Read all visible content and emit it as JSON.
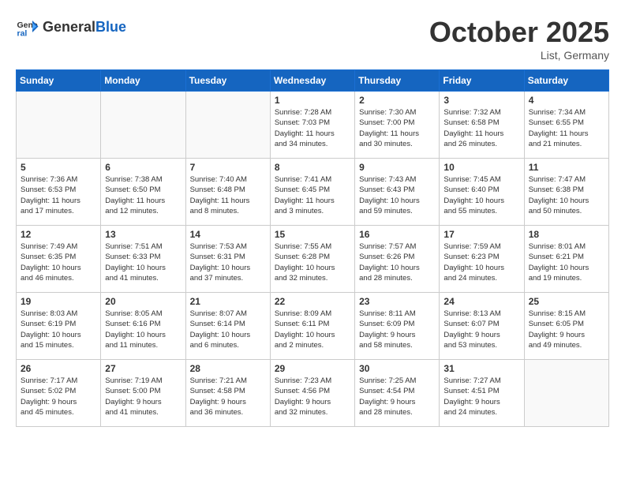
{
  "header": {
    "logo_line1": "General",
    "logo_line2": "Blue",
    "month_title": "October 2025",
    "location": "List, Germany"
  },
  "days_of_week": [
    "Sunday",
    "Monday",
    "Tuesday",
    "Wednesday",
    "Thursday",
    "Friday",
    "Saturday"
  ],
  "weeks": [
    [
      {
        "day": "",
        "info": ""
      },
      {
        "day": "",
        "info": ""
      },
      {
        "day": "",
        "info": ""
      },
      {
        "day": "1",
        "info": "Sunrise: 7:28 AM\nSunset: 7:03 PM\nDaylight: 11 hours\nand 34 minutes."
      },
      {
        "day": "2",
        "info": "Sunrise: 7:30 AM\nSunset: 7:00 PM\nDaylight: 11 hours\nand 30 minutes."
      },
      {
        "day": "3",
        "info": "Sunrise: 7:32 AM\nSunset: 6:58 PM\nDaylight: 11 hours\nand 26 minutes."
      },
      {
        "day": "4",
        "info": "Sunrise: 7:34 AM\nSunset: 6:55 PM\nDaylight: 11 hours\nand 21 minutes."
      }
    ],
    [
      {
        "day": "5",
        "info": "Sunrise: 7:36 AM\nSunset: 6:53 PM\nDaylight: 11 hours\nand 17 minutes."
      },
      {
        "day": "6",
        "info": "Sunrise: 7:38 AM\nSunset: 6:50 PM\nDaylight: 11 hours\nand 12 minutes."
      },
      {
        "day": "7",
        "info": "Sunrise: 7:40 AM\nSunset: 6:48 PM\nDaylight: 11 hours\nand 8 minutes."
      },
      {
        "day": "8",
        "info": "Sunrise: 7:41 AM\nSunset: 6:45 PM\nDaylight: 11 hours\nand 3 minutes."
      },
      {
        "day": "9",
        "info": "Sunrise: 7:43 AM\nSunset: 6:43 PM\nDaylight: 10 hours\nand 59 minutes."
      },
      {
        "day": "10",
        "info": "Sunrise: 7:45 AM\nSunset: 6:40 PM\nDaylight: 10 hours\nand 55 minutes."
      },
      {
        "day": "11",
        "info": "Sunrise: 7:47 AM\nSunset: 6:38 PM\nDaylight: 10 hours\nand 50 minutes."
      }
    ],
    [
      {
        "day": "12",
        "info": "Sunrise: 7:49 AM\nSunset: 6:35 PM\nDaylight: 10 hours\nand 46 minutes."
      },
      {
        "day": "13",
        "info": "Sunrise: 7:51 AM\nSunset: 6:33 PM\nDaylight: 10 hours\nand 41 minutes."
      },
      {
        "day": "14",
        "info": "Sunrise: 7:53 AM\nSunset: 6:31 PM\nDaylight: 10 hours\nand 37 minutes."
      },
      {
        "day": "15",
        "info": "Sunrise: 7:55 AM\nSunset: 6:28 PM\nDaylight: 10 hours\nand 32 minutes."
      },
      {
        "day": "16",
        "info": "Sunrise: 7:57 AM\nSunset: 6:26 PM\nDaylight: 10 hours\nand 28 minutes."
      },
      {
        "day": "17",
        "info": "Sunrise: 7:59 AM\nSunset: 6:23 PM\nDaylight: 10 hours\nand 24 minutes."
      },
      {
        "day": "18",
        "info": "Sunrise: 8:01 AM\nSunset: 6:21 PM\nDaylight: 10 hours\nand 19 minutes."
      }
    ],
    [
      {
        "day": "19",
        "info": "Sunrise: 8:03 AM\nSunset: 6:19 PM\nDaylight: 10 hours\nand 15 minutes."
      },
      {
        "day": "20",
        "info": "Sunrise: 8:05 AM\nSunset: 6:16 PM\nDaylight: 10 hours\nand 11 minutes."
      },
      {
        "day": "21",
        "info": "Sunrise: 8:07 AM\nSunset: 6:14 PM\nDaylight: 10 hours\nand 6 minutes."
      },
      {
        "day": "22",
        "info": "Sunrise: 8:09 AM\nSunset: 6:11 PM\nDaylight: 10 hours\nand 2 minutes."
      },
      {
        "day": "23",
        "info": "Sunrise: 8:11 AM\nSunset: 6:09 PM\nDaylight: 9 hours\nand 58 minutes."
      },
      {
        "day": "24",
        "info": "Sunrise: 8:13 AM\nSunset: 6:07 PM\nDaylight: 9 hours\nand 53 minutes."
      },
      {
        "day": "25",
        "info": "Sunrise: 8:15 AM\nSunset: 6:05 PM\nDaylight: 9 hours\nand 49 minutes."
      }
    ],
    [
      {
        "day": "26",
        "info": "Sunrise: 7:17 AM\nSunset: 5:02 PM\nDaylight: 9 hours\nand 45 minutes."
      },
      {
        "day": "27",
        "info": "Sunrise: 7:19 AM\nSunset: 5:00 PM\nDaylight: 9 hours\nand 41 minutes."
      },
      {
        "day": "28",
        "info": "Sunrise: 7:21 AM\nSunset: 4:58 PM\nDaylight: 9 hours\nand 36 minutes."
      },
      {
        "day": "29",
        "info": "Sunrise: 7:23 AM\nSunset: 4:56 PM\nDaylight: 9 hours\nand 32 minutes."
      },
      {
        "day": "30",
        "info": "Sunrise: 7:25 AM\nSunset: 4:54 PM\nDaylight: 9 hours\nand 28 minutes."
      },
      {
        "day": "31",
        "info": "Sunrise: 7:27 AM\nSunset: 4:51 PM\nDaylight: 9 hours\nand 24 minutes."
      },
      {
        "day": "",
        "info": ""
      }
    ]
  ]
}
